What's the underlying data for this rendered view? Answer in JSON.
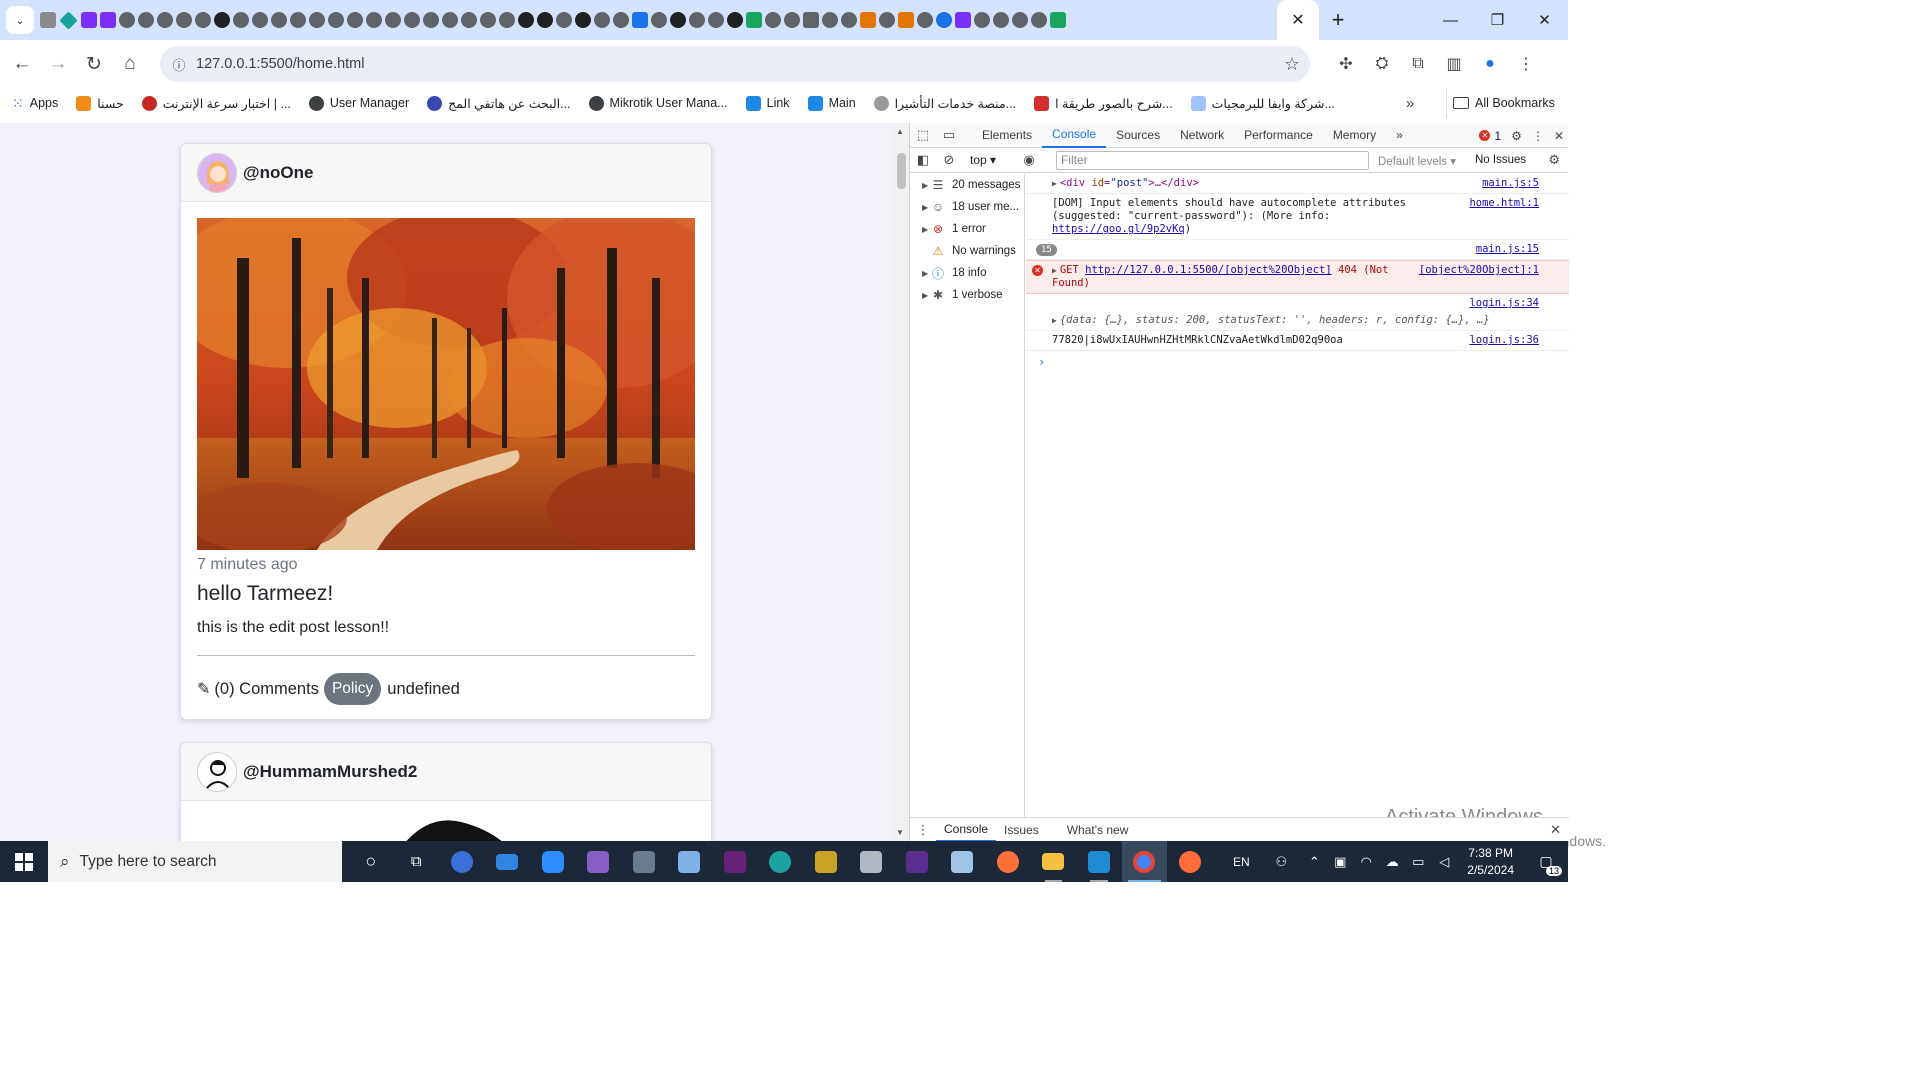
{
  "browser": {
    "url": "127.0.0.1:5500/home.html",
    "bookmarks": [
      {
        "label": "Apps",
        "icon": "apps-grid-icon"
      },
      {
        "label": "حسنا",
        "icon": "bookmark-icon"
      },
      {
        "label": "اختبار سرعة الإنترنت | ...",
        "icon": "speedtest-icon"
      },
      {
        "label": "User Manager",
        "icon": "bookmark-icon"
      },
      {
        "label": "البحث عن هاتفي المج...",
        "icon": "bookmark-icon"
      },
      {
        "label": "Mikrotik User Mana...",
        "icon": "bookmark-icon"
      },
      {
        "label": "Link",
        "icon": "bookmark-icon"
      },
      {
        "label": "Main",
        "icon": "rss-icon"
      },
      {
        "label": "منصة خدمات التأشيرا...",
        "icon": "bookmark-icon"
      },
      {
        "label": "شرح بالصور طريقة ا...",
        "icon": "bookmark-icon"
      },
      {
        "label": "شركة وايفا للبرمجيات...",
        "icon": "bookmark-icon"
      }
    ],
    "all_bookmarks": "All Bookmarks"
  },
  "posts": [
    {
      "username": "@noOne",
      "time": "7 minutes ago",
      "title": "hello Tarmeez!",
      "body": "this is the edit post lesson!!",
      "comments": "(0) Comments",
      "tag": "Policy",
      "extra": "undefined"
    },
    {
      "username": "@HummamMurshed2"
    }
  ],
  "devtools": {
    "tabs": [
      "Elements",
      "Console",
      "Sources",
      "Network",
      "Performance",
      "Memory"
    ],
    "active_tab": "Console",
    "error_count": "1",
    "context": "top",
    "filter_placeholder": "Filter",
    "levels": "Default levels",
    "issues": "No Issues",
    "sidebar": [
      {
        "label": "20 messages",
        "icon": "list-icon"
      },
      {
        "label": "18 user me...",
        "icon": "user-icon"
      },
      {
        "label": "1 error",
        "icon": "error-icon"
      },
      {
        "label": "No warnings",
        "icon": "warning-icon"
      },
      {
        "label": "18 info",
        "icon": "info-icon"
      },
      {
        "label": "1 verbose",
        "icon": "bug-icon"
      }
    ],
    "logs": {
      "div_tag": "div",
      "div_attr": "id",
      "div_val": "\"post\"",
      "div_src": "main.js:5",
      "dom_msg": "[DOM] Input elements should have autocomplete attributes (suggested: \"current-password\"): (More info: ",
      "dom_link": "https://goo.gl/9p2vKq",
      "dom_src": "home.html:1",
      "badge": "15",
      "badge_src": "main.js:15",
      "get_prefix": "GET ",
      "get_url": "http://127.0.0.1:5500/[object%20Object]",
      "get_suffix": " 404 (Not Found)",
      "get_src": "[object%20Object]:1",
      "resp_text": "{data: {…}, status: 200, statusText: '', headers: r, config: {…}, …}",
      "resp_src": "login.js:34",
      "token": "77820|i8wUxIAUHwnHZHtMRklCNZvaAetWkdlmD02q90oa",
      "token_src": "login.js:36"
    },
    "drawer_tabs": [
      "Console",
      "Issues",
      "What's new"
    ],
    "watermark_title": "Activate Windows",
    "watermark_sub": "Go to Settings to activate Windows."
  },
  "taskbar": {
    "search_placeholder": "Type here to search",
    "lang": "EN",
    "time": "7:38 PM",
    "date": "2/5/2024",
    "notifications": "13"
  }
}
